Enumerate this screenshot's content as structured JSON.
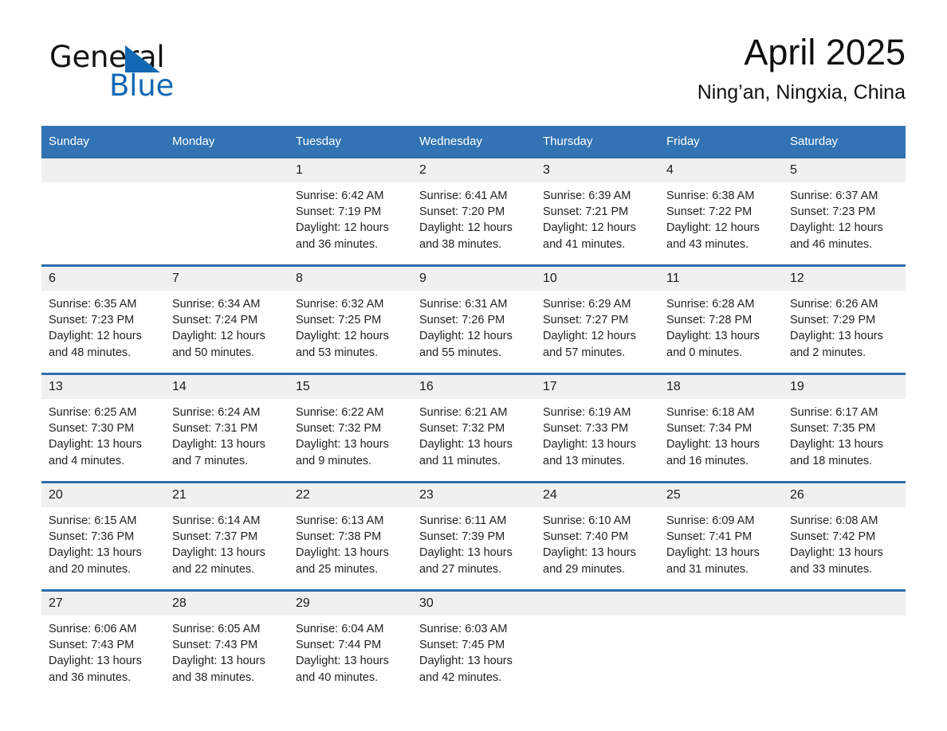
{
  "brand": {
    "name_part1": "General",
    "name_part2": "Blue",
    "triangle_color": "#1268b3",
    "text_color": "#141414"
  },
  "header": {
    "title": "April 2025",
    "subtitle": "Ning’an, Ningxia, China"
  },
  "colors": {
    "header_blue": "#3273b3",
    "row_border_blue": "#2f6fae",
    "daynum_band": "#f0f0f0",
    "page_background": "#ffffff",
    "text": "#222222"
  },
  "calendar": {
    "month": "April",
    "year": "2025",
    "weekday_headers": [
      "Sunday",
      "Monday",
      "Tuesday",
      "Wednesday",
      "Thursday",
      "Friday",
      "Saturday"
    ],
    "weeks": [
      [
        {
          "day": "",
          "lines": []
        },
        {
          "day": "",
          "lines": []
        },
        {
          "day": "1",
          "lines": [
            "Sunrise: 6:42 AM",
            "Sunset: 7:19 PM",
            "Daylight: 12 hours",
            "and 36 minutes."
          ]
        },
        {
          "day": "2",
          "lines": [
            "Sunrise: 6:41 AM",
            "Sunset: 7:20 PM",
            "Daylight: 12 hours",
            "and 38 minutes."
          ]
        },
        {
          "day": "3",
          "lines": [
            "Sunrise: 6:39 AM",
            "Sunset: 7:21 PM",
            "Daylight: 12 hours",
            "and 41 minutes."
          ]
        },
        {
          "day": "4",
          "lines": [
            "Sunrise: 6:38 AM",
            "Sunset: 7:22 PM",
            "Daylight: 12 hours",
            "and 43 minutes."
          ]
        },
        {
          "day": "5",
          "lines": [
            "Sunrise: 6:37 AM",
            "Sunset: 7:23 PM",
            "Daylight: 12 hours",
            "and 46 minutes."
          ]
        }
      ],
      [
        {
          "day": "6",
          "lines": [
            "Sunrise: 6:35 AM",
            "Sunset: 7:23 PM",
            "Daylight: 12 hours",
            "and 48 minutes."
          ]
        },
        {
          "day": "7",
          "lines": [
            "Sunrise: 6:34 AM",
            "Sunset: 7:24 PM",
            "Daylight: 12 hours",
            "and 50 minutes."
          ]
        },
        {
          "day": "8",
          "lines": [
            "Sunrise: 6:32 AM",
            "Sunset: 7:25 PM",
            "Daylight: 12 hours",
            "and 53 minutes."
          ]
        },
        {
          "day": "9",
          "lines": [
            "Sunrise: 6:31 AM",
            "Sunset: 7:26 PM",
            "Daylight: 12 hours",
            "and 55 minutes."
          ]
        },
        {
          "day": "10",
          "lines": [
            "Sunrise: 6:29 AM",
            "Sunset: 7:27 PM",
            "Daylight: 12 hours",
            "and 57 minutes."
          ]
        },
        {
          "day": "11",
          "lines": [
            "Sunrise: 6:28 AM",
            "Sunset: 7:28 PM",
            "Daylight: 13 hours",
            "and 0 minutes."
          ]
        },
        {
          "day": "12",
          "lines": [
            "Sunrise: 6:26 AM",
            "Sunset: 7:29 PM",
            "Daylight: 13 hours",
            "and 2 minutes."
          ]
        }
      ],
      [
        {
          "day": "13",
          "lines": [
            "Sunrise: 6:25 AM",
            "Sunset: 7:30 PM",
            "Daylight: 13 hours",
            "and 4 minutes."
          ]
        },
        {
          "day": "14",
          "lines": [
            "Sunrise: 6:24 AM",
            "Sunset: 7:31 PM",
            "Daylight: 13 hours",
            "and 7 minutes."
          ]
        },
        {
          "day": "15",
          "lines": [
            "Sunrise: 6:22 AM",
            "Sunset: 7:32 PM",
            "Daylight: 13 hours",
            "and 9 minutes."
          ]
        },
        {
          "day": "16",
          "lines": [
            "Sunrise: 6:21 AM",
            "Sunset: 7:32 PM",
            "Daylight: 13 hours",
            "and 11 minutes."
          ]
        },
        {
          "day": "17",
          "lines": [
            "Sunrise: 6:19 AM",
            "Sunset: 7:33 PM",
            "Daylight: 13 hours",
            "and 13 minutes."
          ]
        },
        {
          "day": "18",
          "lines": [
            "Sunrise: 6:18 AM",
            "Sunset: 7:34 PM",
            "Daylight: 13 hours",
            "and 16 minutes."
          ]
        },
        {
          "day": "19",
          "lines": [
            "Sunrise: 6:17 AM",
            "Sunset: 7:35 PM",
            "Daylight: 13 hours",
            "and 18 minutes."
          ]
        }
      ],
      [
        {
          "day": "20",
          "lines": [
            "Sunrise: 6:15 AM",
            "Sunset: 7:36 PM",
            "Daylight: 13 hours",
            "and 20 minutes."
          ]
        },
        {
          "day": "21",
          "lines": [
            "Sunrise: 6:14 AM",
            "Sunset: 7:37 PM",
            "Daylight: 13 hours",
            "and 22 minutes."
          ]
        },
        {
          "day": "22",
          "lines": [
            "Sunrise: 6:13 AM",
            "Sunset: 7:38 PM",
            "Daylight: 13 hours",
            "and 25 minutes."
          ]
        },
        {
          "day": "23",
          "lines": [
            "Sunrise: 6:11 AM",
            "Sunset: 7:39 PM",
            "Daylight: 13 hours",
            "and 27 minutes."
          ]
        },
        {
          "day": "24",
          "lines": [
            "Sunrise: 6:10 AM",
            "Sunset: 7:40 PM",
            "Daylight: 13 hours",
            "and 29 minutes."
          ]
        },
        {
          "day": "25",
          "lines": [
            "Sunrise: 6:09 AM",
            "Sunset: 7:41 PM",
            "Daylight: 13 hours",
            "and 31 minutes."
          ]
        },
        {
          "day": "26",
          "lines": [
            "Sunrise: 6:08 AM",
            "Sunset: 7:42 PM",
            "Daylight: 13 hours",
            "and 33 minutes."
          ]
        }
      ],
      [
        {
          "day": "27",
          "lines": [
            "Sunrise: 6:06 AM",
            "Sunset: 7:43 PM",
            "Daylight: 13 hours",
            "and 36 minutes."
          ]
        },
        {
          "day": "28",
          "lines": [
            "Sunrise: 6:05 AM",
            "Sunset: 7:43 PM",
            "Daylight: 13 hours",
            "and 38 minutes."
          ]
        },
        {
          "day": "29",
          "lines": [
            "Sunrise: 6:04 AM",
            "Sunset: 7:44 PM",
            "Daylight: 13 hours",
            "and 40 minutes."
          ]
        },
        {
          "day": "30",
          "lines": [
            "Sunrise: 6:03 AM",
            "Sunset: 7:45 PM",
            "Daylight: 13 hours",
            "and 42 minutes."
          ]
        },
        {
          "day": "",
          "lines": []
        },
        {
          "day": "",
          "lines": []
        },
        {
          "day": "",
          "lines": []
        }
      ]
    ]
  }
}
